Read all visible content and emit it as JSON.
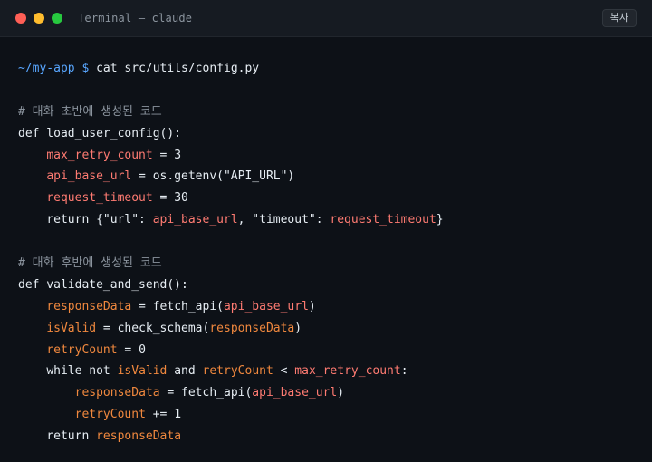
{
  "window": {
    "title": "Terminal — claude",
    "copy_label": "복사"
  },
  "colors": {
    "background": "#0d1117",
    "titlebar": "#161b22",
    "prompt": "#58a6ff",
    "comment": "#8b949e",
    "text": "#e6edf3",
    "var_red": "#ff7b72",
    "var_orange": "#f0883e",
    "dot_red": "#ff5f56",
    "dot_yellow": "#ffbd2e",
    "dot_green": "#27c93f"
  },
  "terminal": {
    "prompt_path": "~/my-app",
    "prompt_sign": "$",
    "command": "cat src/utils/config.py",
    "comment_early": "# 대화 초반에 생성된 코드",
    "def_load": "def load_user_config():",
    "l1_var": "max_retry_count",
    "l1_rest": " = 3",
    "l2_var": "api_base_url",
    "l2_rest": " = os.getenv(\"API_URL\")",
    "l3_var": "request_timeout",
    "l3_rest": " = 30",
    "l4_a": "return {\"url\": ",
    "l4_var1": "api_base_url",
    "l4_b": ", \"timeout\": ",
    "l4_var2": "request_timeout",
    "l4_c": "}",
    "comment_late": "# 대화 후반에 생성된 코드",
    "def_validate": "def validate_and_send():",
    "m1_var": "responseData",
    "m1_a": " = fetch_api(",
    "m1_arg": "api_base_url",
    "m1_b": ")",
    "m2_var": "isValid",
    "m2_a": " = check_schema(",
    "m2_arg": "responseData",
    "m2_b": ")",
    "m3_var": "retryCount",
    "m3_rest": " = 0",
    "m4_a": "while not ",
    "m4_var1": "isValid",
    "m4_b": " and ",
    "m4_var2": "retryCount",
    "m4_c": " < ",
    "m4_var3": "max_retry_count",
    "m4_d": ":",
    "m5_var": "responseData",
    "m5_a": " = fetch_api(",
    "m5_arg": "api_base_url",
    "m5_b": ")",
    "m6_var": "retryCount",
    "m6_rest": " += 1",
    "m7_a": "return ",
    "m7_var": "responseData"
  }
}
